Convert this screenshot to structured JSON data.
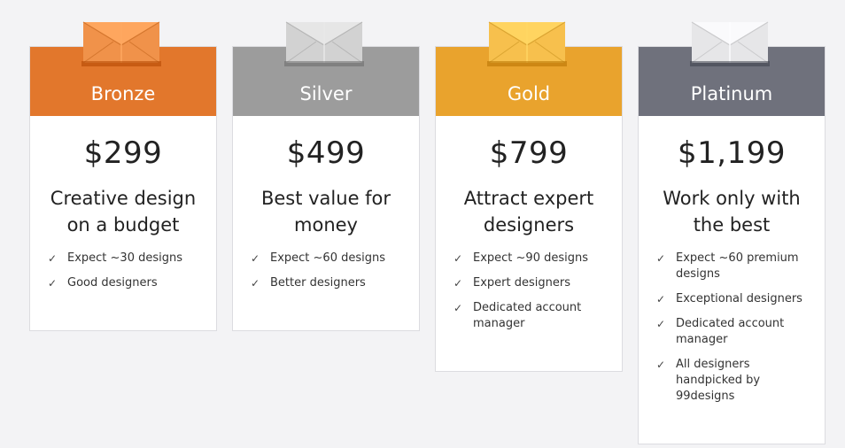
{
  "plans": [
    {
      "name": "Bronze",
      "color": "#e2772c",
      "envelope_color": "#f0924a",
      "price": "$299",
      "tagline": "Creative design on a budget",
      "features": [
        "Expect ~30 designs",
        "Good designers"
      ]
    },
    {
      "name": "Silver",
      "color": "#9c9c9c",
      "envelope_color": "#d2d2d2",
      "price": "$499",
      "tagline": "Best value for money",
      "features": [
        "Expect ~60 designs",
        "Better designers"
      ]
    },
    {
      "name": "Gold",
      "color": "#e9a32d",
      "envelope_color": "#f7c04d",
      "price": "$799",
      "tagline": "Attract expert designers",
      "features": [
        "Expect ~90 designs",
        "Expert designers",
        "Dedicated account manager"
      ]
    },
    {
      "name": "Platinum",
      "color": "#6f717c",
      "envelope_color": "#e6e6e8",
      "price": "$1,199",
      "tagline": "Work only with the best",
      "features": [
        "Expect ~60 premium designs",
        "Exceptional designers",
        "Dedicated account manager",
        "All designers handpicked by 99designs"
      ]
    }
  ],
  "icons": {
    "feature": "checkmark-icon",
    "plan": "envelope-icon"
  },
  "check_glyph": "✓"
}
